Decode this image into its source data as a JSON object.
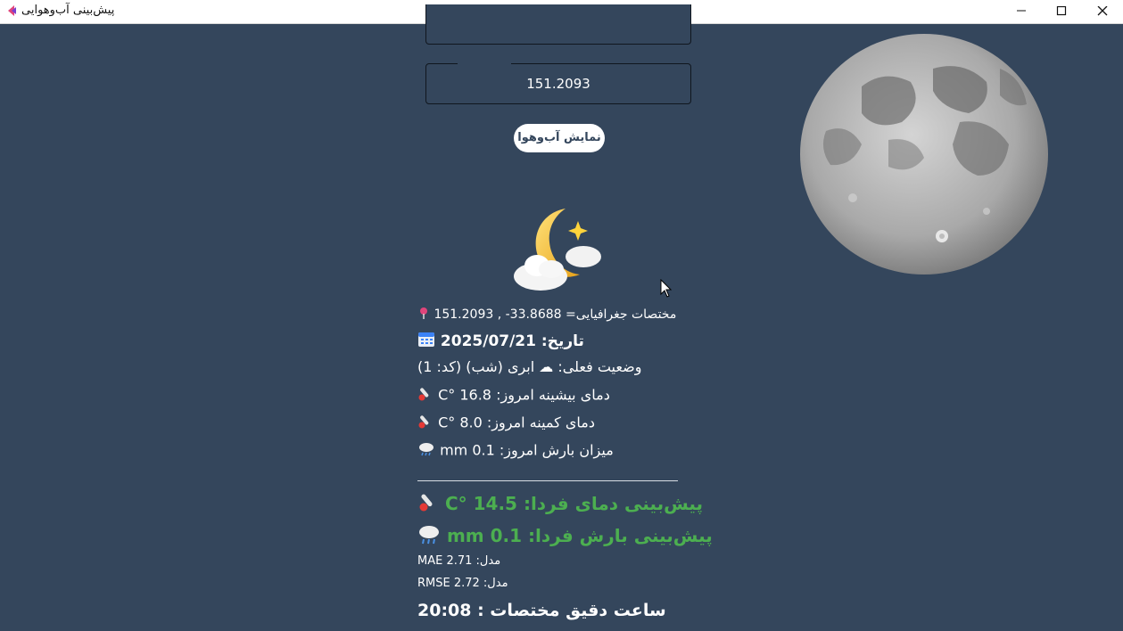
{
  "window": {
    "title": "پیش‌بینی آب‌وهوایی"
  },
  "form": {
    "latitude_value": "",
    "longitude_value": "151.2093",
    "show_button_label": "نمایش آب‌وهوا"
  },
  "weather": {
    "coords_text": "مختصات جغرافیایی= 33.8688- , 151.2093",
    "date_text": "تاریخ: 2025/07/21",
    "status_text": "وضعیت فعلی: ☁ ابری (شب) (کد: 1)",
    "max_temp_text": "دمای بیشینه امروز: 16.8 °C",
    "min_temp_text": "دمای کمینه امروز: 8.0 °C",
    "rain_text": "میزان بارش امروز: 0.1 mm"
  },
  "forecast": {
    "temp_text": "پیش‌بینی دمای فردا: 14.5 °C",
    "rain_text": "پیش‌بینی بارش فردا: 0.1 mm"
  },
  "model": {
    "mae_text": "مدل: MAE 2.71",
    "rmse_text": "مدل: RMSE 2.72"
  },
  "clock": {
    "text": "ساعت دقیق مختصات : 20:08"
  },
  "colors": {
    "background": "#34465c",
    "forecast_green": "#4caf50",
    "button_text": "#34465c"
  },
  "icons": {
    "app": "app-icon",
    "weather": "moon-cloud-icon",
    "moon_image": "moon-image"
  }
}
